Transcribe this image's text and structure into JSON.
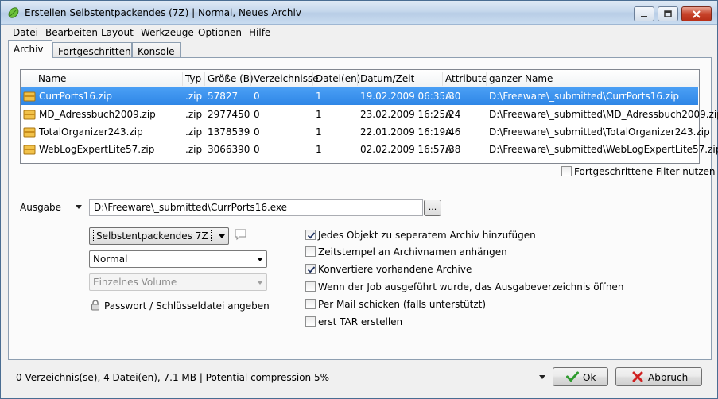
{
  "window": {
    "title": "Erstellen Selbstentpackendes (7Z) | Normal, Neues Archiv"
  },
  "menu": [
    "Datei",
    "Bearbeiten",
    "Layout",
    "Werkzeuge",
    "Optionen",
    "Hilfe"
  ],
  "tabs": [
    {
      "label": "Archiv",
      "active": true
    },
    {
      "label": "Fortgeschritten",
      "active": false
    },
    {
      "label": "Konsole",
      "active": false
    }
  ],
  "file_list": {
    "columns": [
      "Name",
      "Typ",
      "Größe (B)",
      "Verzeichnisse",
      "Datei(en)",
      "Datum/Zeit",
      "Attribute",
      "ganzer Name"
    ],
    "rows": [
      {
        "name": "CurrPorts16.zip",
        "type": ".zip",
        "size": "57827",
        "dirs": "0",
        "files": "1",
        "date": "19.02.2009 06:35:30",
        "attr": "A",
        "full": "D:\\Freeware\\_submitted\\CurrPorts16.zip",
        "selected": true
      },
      {
        "name": "MD_Adressbuch2009.zip",
        "type": ".zip",
        "size": "2977450",
        "dirs": "0",
        "files": "1",
        "date": "23.02.2009 16:25:24",
        "attr": "A",
        "full": "D:\\Freeware\\_submitted\\MD_Adressbuch2009.zip",
        "selected": false
      },
      {
        "name": "TotalOrganizer243.zip",
        "type": ".zip",
        "size": "1378539",
        "dirs": "0",
        "files": "1",
        "date": "22.01.2009 16:19:46",
        "attr": "A",
        "full": "D:\\Freeware\\_submitted\\TotalOrganizer243.zip",
        "selected": false
      },
      {
        "name": "WebLogExpertLite57.zip",
        "type": ".zip",
        "size": "3066390",
        "dirs": "0",
        "files": "1",
        "date": "02.02.2009 16:57:38",
        "attr": "A",
        "full": "D:\\Freeware\\_submitted\\WebLogExpertLite57.zip",
        "selected": false
      }
    ]
  },
  "advanced_filter": {
    "label": "Fortgeschrittene Filter nutzen",
    "checked": false
  },
  "output": {
    "label": "Ausgabe",
    "path": "D:\\Freeware\\_submitted\\CurrPorts16.exe",
    "browse_label": "..."
  },
  "format_select": {
    "value": "Selbstentpackendes 7Z"
  },
  "compression_select": {
    "value": "Normal"
  },
  "volume_select": {
    "value": "Einzelnes Volume"
  },
  "password_label": "Passwort / Schlüsseldatei angeben",
  "options": [
    {
      "label": "Jedes Objekt zu seperatem Archiv hinzufügen",
      "checked": true
    },
    {
      "label": "Zeitstempel an Archivnamen anhängen",
      "checked": false
    },
    {
      "label": "Konvertiere vorhandene Archive",
      "checked": true
    },
    {
      "label": "Wenn der Job ausgeführt wurde, das Ausgabeverzeichnis öffnen",
      "checked": false
    },
    {
      "label": "Per Mail schicken (falls unterstützt)",
      "checked": false
    },
    {
      "label": "erst TAR erstellen",
      "checked": false
    }
  ],
  "status": "0 Verzeichnis(se), 4 Datei(en), 7.1 MB | Potential compression 5%",
  "buttons": {
    "ok": "Ok",
    "cancel": "Abbruch"
  },
  "colors": {
    "selection": "#3390ea",
    "titlebar": "#c5d7ec",
    "ok_icon": "#2e9b2e",
    "cancel_icon": "#d02020"
  }
}
